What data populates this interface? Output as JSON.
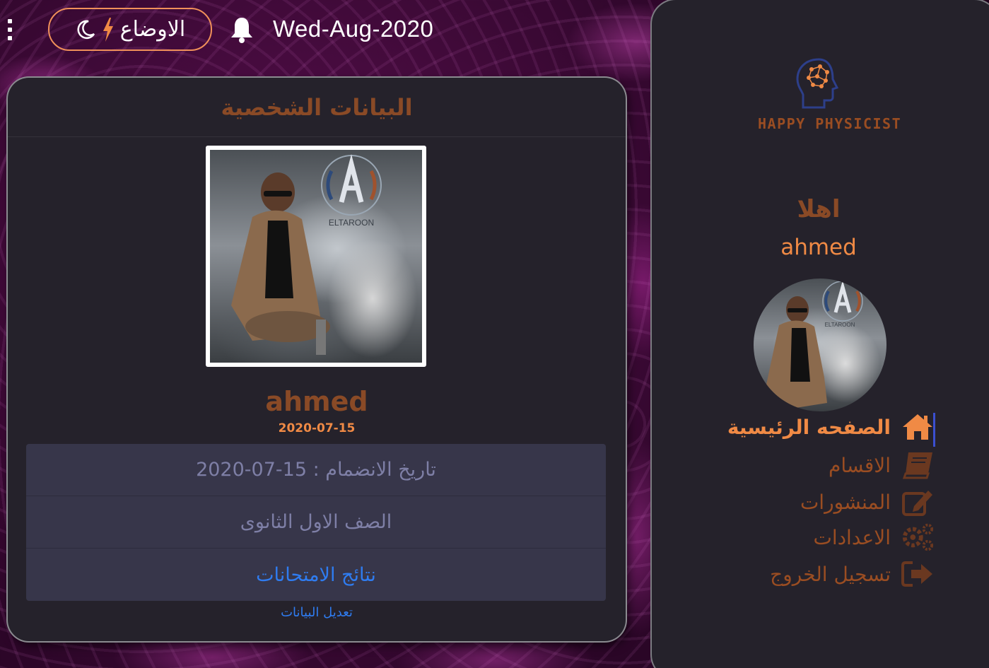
{
  "topbar": {
    "mode_label": "الاوضاع",
    "date": "Wed-Aug-2020"
  },
  "icons": {
    "menu": "kebab-icon",
    "mode_moon": "moon-icon",
    "mode_bolt": "bolt-icon",
    "notifications": "bell-icon"
  },
  "profile": {
    "title": "البيانات الشخصية",
    "photo_watermark": "ELTAROON",
    "name": "ahmed",
    "date": "2020-07-15",
    "info_rows": [
      "تاريخ الانضمام : 15-07-2020",
      "الصف الاول الثانوى",
      "نتائج الامتحانات"
    ],
    "edit_link": "تعديل البيانات"
  },
  "sidebar": {
    "logo_text": "HAPPY PHYSICIST",
    "greeting": "اهلا",
    "username": "ahmed",
    "avatar_watermark": "ELTAROON",
    "nav": [
      {
        "label": "الصفحه الرئيسية",
        "icon": "home-icon",
        "active": true
      },
      {
        "label": "الاقسام",
        "icon": "book-icon",
        "active": false
      },
      {
        "label": "المنشورات",
        "icon": "edit-icon",
        "active": false
      },
      {
        "label": "الاعدادات",
        "icon": "gears-icon",
        "active": false
      },
      {
        "label": "تسجيل الخروج",
        "icon": "sign-out-icon",
        "active": false
      }
    ]
  },
  "colors": {
    "accent_orange": "#f08a45",
    "accent_brown": "#8a4a26",
    "panel_bg": "#25222b",
    "link_blue": "#2f7cf0"
  }
}
